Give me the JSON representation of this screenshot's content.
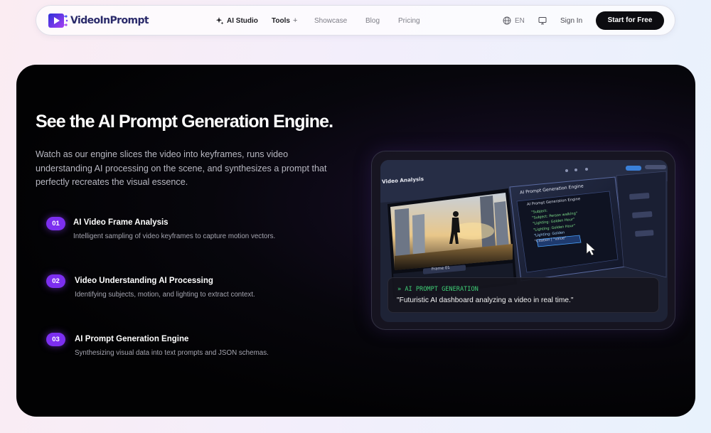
{
  "nav": {
    "logo_text": "VideoInPrompt",
    "links": {
      "ai_studio": "AI Studio",
      "tools": "Tools",
      "tools_plus": "+",
      "showcase": "Showcase",
      "blog": "Blog",
      "pricing": "Pricing"
    },
    "lang": "EN",
    "sign_in": "Sign In",
    "cta": "Start for Free"
  },
  "hero": {
    "title": "See the AI Prompt Generation Engine.",
    "description": "Watch as our engine slices the video into keyframes, runs video understanding AI processing on the scene, and synthesizes a prompt that perfectly recreates the visual essence.",
    "steps": [
      {
        "num": "01",
        "title": "AI Video Frame Analysis",
        "desc": "Intelligent sampling of video keyframes to capture motion vectors."
      },
      {
        "num": "02",
        "title": "Video Understanding AI Processing",
        "desc": "Identifying subjects, motion, and lighting to extract context."
      },
      {
        "num": "03",
        "title": "AI Prompt Generation Engine",
        "desc": "Synthesizing visual data into text prompts and JSON schemas."
      }
    ]
  },
  "preview": {
    "screen": {
      "video_title": "Video Analysis",
      "frame_label": "Frame 01",
      "panel_title": "AI Prompt Generation Engine",
      "panel_subtitle": "AI Prompt Generation Engine",
      "code_lines": [
        "\"Subject:",
        "\"Subject: Person walking\"",
        "\"Lighting: Golden Hour\"",
        "\"Lighting: Golden Hour\"",
        "\"Lighting: Golden",
        "\"Citation | \"value\""
      ]
    },
    "caption_label": "» AI PROMPT GENERATION",
    "caption_text": "\"Futuristic AI dashboard analyzing a video in real time.\""
  },
  "colors": {
    "accent": "#7c2ff0",
    "caption_label": "#3fce76",
    "cta_bg": "#0c0c10"
  },
  "icons": [
    "logo-mark-icon",
    "sparkle-icon",
    "globe-icon",
    "monitor-icon",
    "cursor-icon"
  ]
}
